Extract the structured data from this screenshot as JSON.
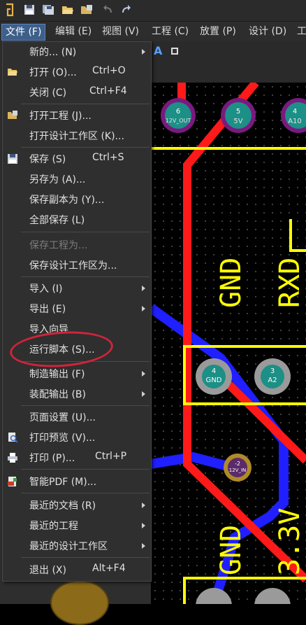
{
  "menubar": {
    "items": [
      {
        "label": "文件 (F)"
      },
      {
        "label": "编辑 (E)"
      },
      {
        "label": "视图 (V)"
      },
      {
        "label": "工程 (C)"
      },
      {
        "label": "放置 (P)"
      },
      {
        "label": "设计 (D)"
      },
      {
        "label": "工"
      }
    ]
  },
  "file_menu": {
    "items": [
      {
        "label": "新的... (N)",
        "shortcut": ""
      },
      {
        "label": "打开 (O)...",
        "shortcut": "Ctrl+O"
      },
      {
        "label": "关闭 (C)",
        "shortcut": "Ctrl+F4"
      },
      {
        "label": "打开工程 (J)...",
        "shortcut": ""
      },
      {
        "label": "打开设计工作区 (K)...",
        "shortcut": ""
      },
      {
        "label": "保存 (S)",
        "shortcut": "Ctrl+S"
      },
      {
        "label": "另存为 (A)...",
        "shortcut": ""
      },
      {
        "label": "保存副本为 (Y)...",
        "shortcut": ""
      },
      {
        "label": "全部保存 (L)",
        "shortcut": ""
      },
      {
        "label": "保存工程为...",
        "shortcut": ""
      },
      {
        "label": "保存设计工作区为...",
        "shortcut": ""
      },
      {
        "label": "导入 (I)",
        "shortcut": ""
      },
      {
        "label": "导出 (E)",
        "shortcut": ""
      },
      {
        "label": "导入向导",
        "shortcut": ""
      },
      {
        "label": "运行脚本 (S)...",
        "shortcut": ""
      },
      {
        "label": "制造输出 (F)",
        "shortcut": ""
      },
      {
        "label": "装配输出 (B)",
        "shortcut": ""
      },
      {
        "label": "页面设置 (U)...",
        "shortcut": ""
      },
      {
        "label": "打印预览 (V)...",
        "shortcut": ""
      },
      {
        "label": "打印 (P)...",
        "shortcut": "Ctrl+P"
      },
      {
        "label": "智能PDF (M)...",
        "shortcut": ""
      },
      {
        "label": "最近的文档 (R)",
        "shortcut": ""
      },
      {
        "label": "最近的工程",
        "shortcut": ""
      },
      {
        "label": "最近的设计工作区",
        "shortcut": ""
      },
      {
        "label": "退出 (X)",
        "shortcut": "Alt+F4"
      }
    ]
  },
  "pcb": {
    "pads": [
      {
        "num": "6",
        "net": "12V_OUT"
      },
      {
        "num": "5",
        "net": "5V"
      },
      {
        "num": "4",
        "net": "A10"
      },
      {
        "num": "4",
        "net": "GND"
      },
      {
        "num": "3",
        "net": "A2"
      },
      {
        "num": "-2",
        "net": "12V_IN"
      }
    ],
    "silk_labels": [
      "GND",
      "RXD",
      "GND",
      "3.3V"
    ]
  },
  "colors": {
    "accent": "#3e5f8a",
    "annotation": "#d0243a",
    "track_red": "#ff1a1a",
    "track_blue": "#1f1fff",
    "silk_yellow": "#ffff00",
    "pad_teal": "#1c8f86"
  }
}
